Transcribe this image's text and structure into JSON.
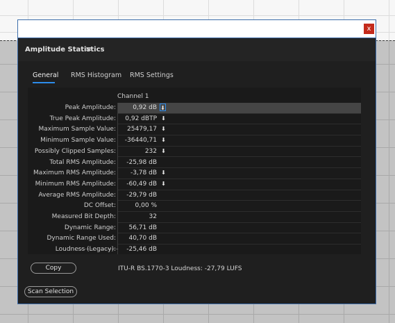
{
  "window": {
    "close_label": "x"
  },
  "panel": {
    "title": "Amplitude Statistics",
    "menu_icon": "≡"
  },
  "tabs": [
    {
      "label": "General",
      "active": true
    },
    {
      "label": "RMS Histogram",
      "active": false
    },
    {
      "label": "RMS Settings",
      "active": false
    }
  ],
  "stats": {
    "column_header": "Channel 1",
    "rows": [
      {
        "label": "Peak Amplitude:",
        "value": "0,92 dB",
        "pin": true,
        "selected": true
      },
      {
        "label": "True Peak Amplitude:",
        "value": "0,92 dBTP",
        "pin": true
      },
      {
        "label": "Maximum Sample Value:",
        "value": "25479,17",
        "pin": true
      },
      {
        "label": "Minimum Sample Value:",
        "value": "-36440,71",
        "pin": true
      },
      {
        "label": "Possibly Clipped Samples:",
        "value": "232",
        "pin": true
      },
      {
        "label": "Total RMS Amplitude:",
        "value": "-25,98 dB",
        "pin": false
      },
      {
        "label": "Maximum RMS Amplitude:",
        "value": "-3,78 dB",
        "pin": true
      },
      {
        "label": "Minimum RMS Amplitude:",
        "value": "-60,49 dB",
        "pin": true
      },
      {
        "label": "Average RMS Amplitude:",
        "value": "-29,79 dB",
        "pin": false
      },
      {
        "label": "DC Offset:",
        "value": "0,00 %",
        "pin": false
      },
      {
        "label": "Measured Bit Depth:",
        "value": "32",
        "pin": false
      },
      {
        "label": "Dynamic Range:",
        "value": "56,71 dB",
        "pin": false
      },
      {
        "label": "Dynamic Range Used:",
        "value": "40,70 dB",
        "pin": false
      },
      {
        "label": "Loudness (Legacy):",
        "value": "-25,46 dB",
        "pin": false
      }
    ],
    "pin_glyph": "⬇"
  },
  "footer": {
    "copy_label": "Copy",
    "loudness_text": "ITU-R BS.1770-3 Loudness: -27,79 LUFS",
    "scan_label": "Scan Selection"
  },
  "colors": {
    "accent": "#2d8ceb",
    "window_border": "#3d6dab",
    "close_button": "#c42b1c",
    "panel_bg": "#1f1f1f"
  }
}
